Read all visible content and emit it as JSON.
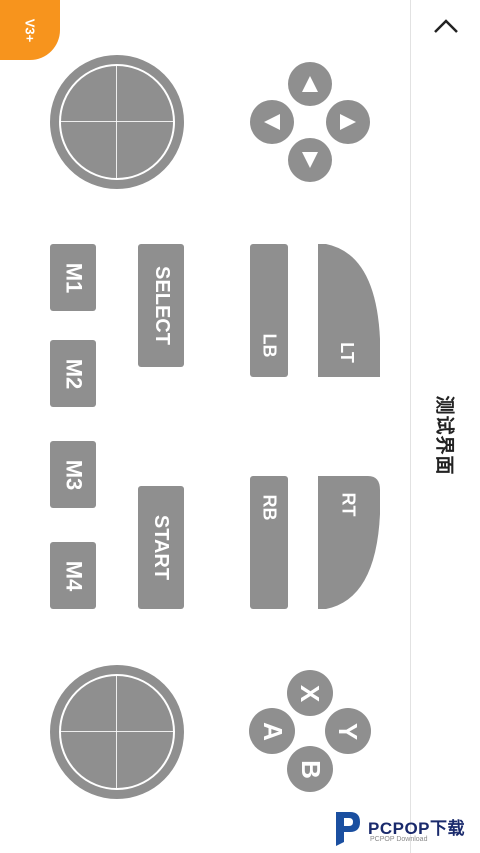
{
  "panel": {
    "title": "测试界面",
    "collapse_icon": "chevron-up-icon"
  },
  "app_badge": {
    "label": "V3+",
    "icon": "gamepad-icon"
  },
  "left_stick": {
    "name": "left-stick"
  },
  "right_stick": {
    "name": "right-stick"
  },
  "dpad": [
    "up",
    "left",
    "right",
    "down"
  ],
  "macro_buttons": [
    "M1",
    "M2",
    "M3",
    "M4"
  ],
  "system_buttons": {
    "select": "SELECT",
    "start": "START"
  },
  "shoulders": {
    "lb": "LB",
    "lt": "LT",
    "rb": "RB",
    "rt": "RT"
  },
  "face_buttons": {
    "x": "X",
    "y": "Y",
    "a": "A",
    "b": "B"
  },
  "watermark": {
    "text": "PCPOP下载",
    "sub": "PCPOP Download"
  },
  "colors": {
    "button": "#8f8f8f",
    "badge": "#f7941d",
    "background": "#ffffff"
  }
}
